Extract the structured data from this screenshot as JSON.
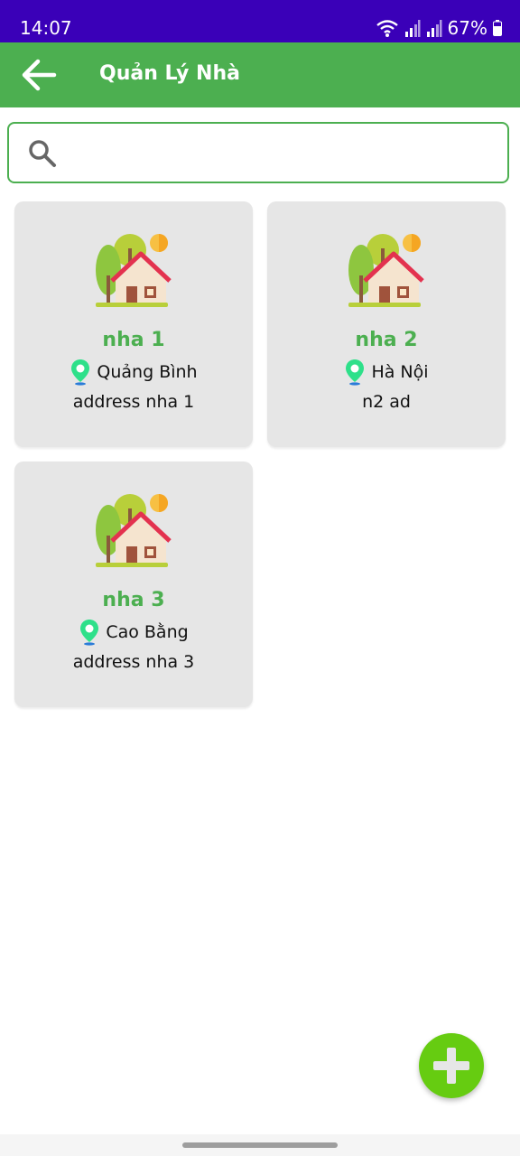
{
  "status": {
    "time": "14:07",
    "battery": "67%"
  },
  "appbar": {
    "title": "Quản Lý Nhà"
  },
  "search": {
    "value": "",
    "placeholder": ""
  },
  "houses": [
    {
      "name": "nha 1",
      "province": "Quảng Bình",
      "address": "address nha 1"
    },
    {
      "name": "nha 2",
      "province": "Hà Nội",
      "address": "n2 ad"
    },
    {
      "name": "nha 3",
      "province": "Cao Bằng",
      "address": "address nha 3"
    }
  ],
  "colors": {
    "status_bar": "#3a00b8",
    "app_bar": "#4caf50",
    "card_bg": "#e6e6e6",
    "fab": "#66cc11"
  },
  "icons": {
    "back": "arrow-left-icon",
    "search": "search-icon",
    "house": "house-icon",
    "location": "map-pin-icon",
    "add": "plus-icon"
  }
}
